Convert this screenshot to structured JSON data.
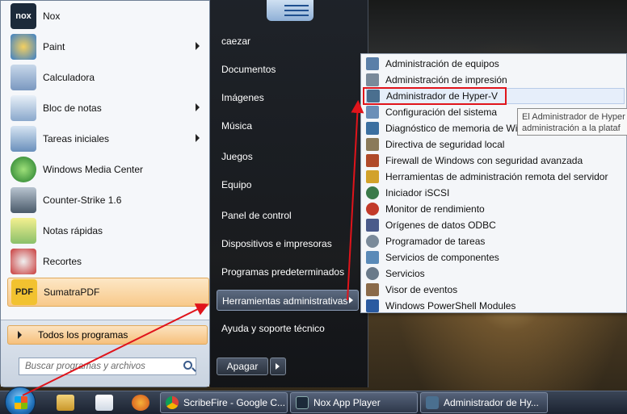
{
  "start_menu": {
    "programs": [
      {
        "label": "Nox",
        "icon": "nox-icon",
        "has_submenu": false
      },
      {
        "label": "Paint",
        "icon": "paint-icon",
        "has_submenu": true
      },
      {
        "label": "Calculadora",
        "icon": "calculator-icon",
        "has_submenu": false
      },
      {
        "label": "Bloc de notas",
        "icon": "notepad-icon",
        "has_submenu": true
      },
      {
        "label": "Tareas iniciales",
        "icon": "getting-started-icon",
        "has_submenu": true
      },
      {
        "label": "Windows Media Center",
        "icon": "media-center-icon",
        "has_submenu": false
      },
      {
        "label": "Counter-Strike 1.6",
        "icon": "counter-strike-icon",
        "has_submenu": false
      },
      {
        "label": "Notas rápidas",
        "icon": "sticky-notes-icon",
        "has_submenu": false
      },
      {
        "label": "Recortes",
        "icon": "snipping-tool-icon",
        "has_submenu": false
      },
      {
        "label": "SumatraPDF",
        "icon": "sumatrapdf-icon",
        "has_submenu": false
      }
    ],
    "nox_icon_text": "nox",
    "sumatra_icon_text": "PDF",
    "all_programs": "Todos los programas",
    "search_placeholder": "Buscar programas y archivos",
    "right_items": {
      "user": "caezar",
      "documents": "Documentos",
      "pictures": "Imágenes",
      "music": "Música",
      "games": "Juegos",
      "computer": "Equipo",
      "control_panel": "Panel de control",
      "devices": "Dispositivos e impresoras",
      "default_programs": "Programas predeterminados",
      "admin_tools": "Herramientas administrativas",
      "help": "Ayuda y soporte técnico"
    },
    "shutdown": "Apagar"
  },
  "submenu": {
    "items": [
      {
        "label": "Administración de equipos",
        "color": "#5a7fa8"
      },
      {
        "label": "Administración de impresión",
        "color": "#7a8a9a"
      },
      {
        "label": "Administrador de Hyper-V",
        "color": "#4a6f8f"
      },
      {
        "label": "Configuración del sistema",
        "color": "#6b8fb8"
      },
      {
        "label": "Diagnóstico de memoria de Windows",
        "color": "#3b6fa0"
      },
      {
        "label": "Directiva de seguridad local",
        "color": "#8a7a5a"
      },
      {
        "label": "Firewall de Windows con seguridad avanzada",
        "color": "#b04a2a"
      },
      {
        "label": "Herramientas de administración remota del servidor",
        "color": "#d2a22a"
      },
      {
        "label": "Iniciador iSCSI",
        "color": "#3a7a4a"
      },
      {
        "label": "Monitor de rendimiento",
        "color": "#c23a2a"
      },
      {
        "label": "Orígenes de datos ODBC",
        "color": "#4a5a8a"
      },
      {
        "label": "Programador de tareas",
        "color": "#7a8a9a"
      },
      {
        "label": "Servicios de componentes",
        "color": "#5a8ab8"
      },
      {
        "label": "Servicios",
        "color": "#6a7a8a"
      },
      {
        "label": "Visor de eventos",
        "color": "#8a6a4a"
      },
      {
        "label": "Windows PowerShell Modules",
        "color": "#2a5aa0"
      }
    ],
    "highlighted_index": 2
  },
  "tooltip": {
    "line1": "El Administrador de Hyper",
    "line2": "administración a la plataf"
  },
  "taskbar": {
    "tasks": [
      {
        "label": "ScribeFire - Google C...",
        "icon": "chrome-icon"
      },
      {
        "label": "Nox App Player",
        "icon": "nox-app-icon"
      },
      {
        "label": "Administrador de Hy...",
        "icon": "hyperv-icon"
      }
    ]
  },
  "colors": {
    "annotation_red": "#e0141b",
    "highlight_orange": "#f8c98a"
  }
}
